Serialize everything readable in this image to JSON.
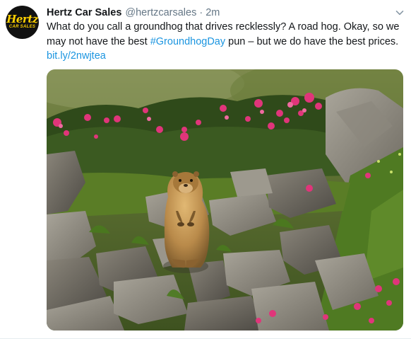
{
  "account": {
    "display_name": "Hertz Car Sales",
    "handle": "@hertzcarsales",
    "separator": "·",
    "time": "2m",
    "avatar_logo": "Hertz",
    "avatar_logo_sub": "CAR SALES"
  },
  "tweet": {
    "line1": "What do you call a groundhog that drives recklessly? A road hog. Okay, so we",
    "line2_pre": "may not have the best ",
    "hashtag": "#GroundhogDay",
    "line2_post": " pun – but we do have the best prices.",
    "link": "bit.ly/2nwjtea"
  },
  "media": {
    "subject": "marmot standing among rocks and pink alpine rhododendron flowers"
  },
  "icons": {
    "menu": "chevron-down-icon"
  },
  "colors": {
    "name": "#14171a",
    "secondary": "#657786",
    "link": "#1b95e0",
    "avatar_bg": "#111111",
    "logo_yellow": "#ffd100"
  }
}
